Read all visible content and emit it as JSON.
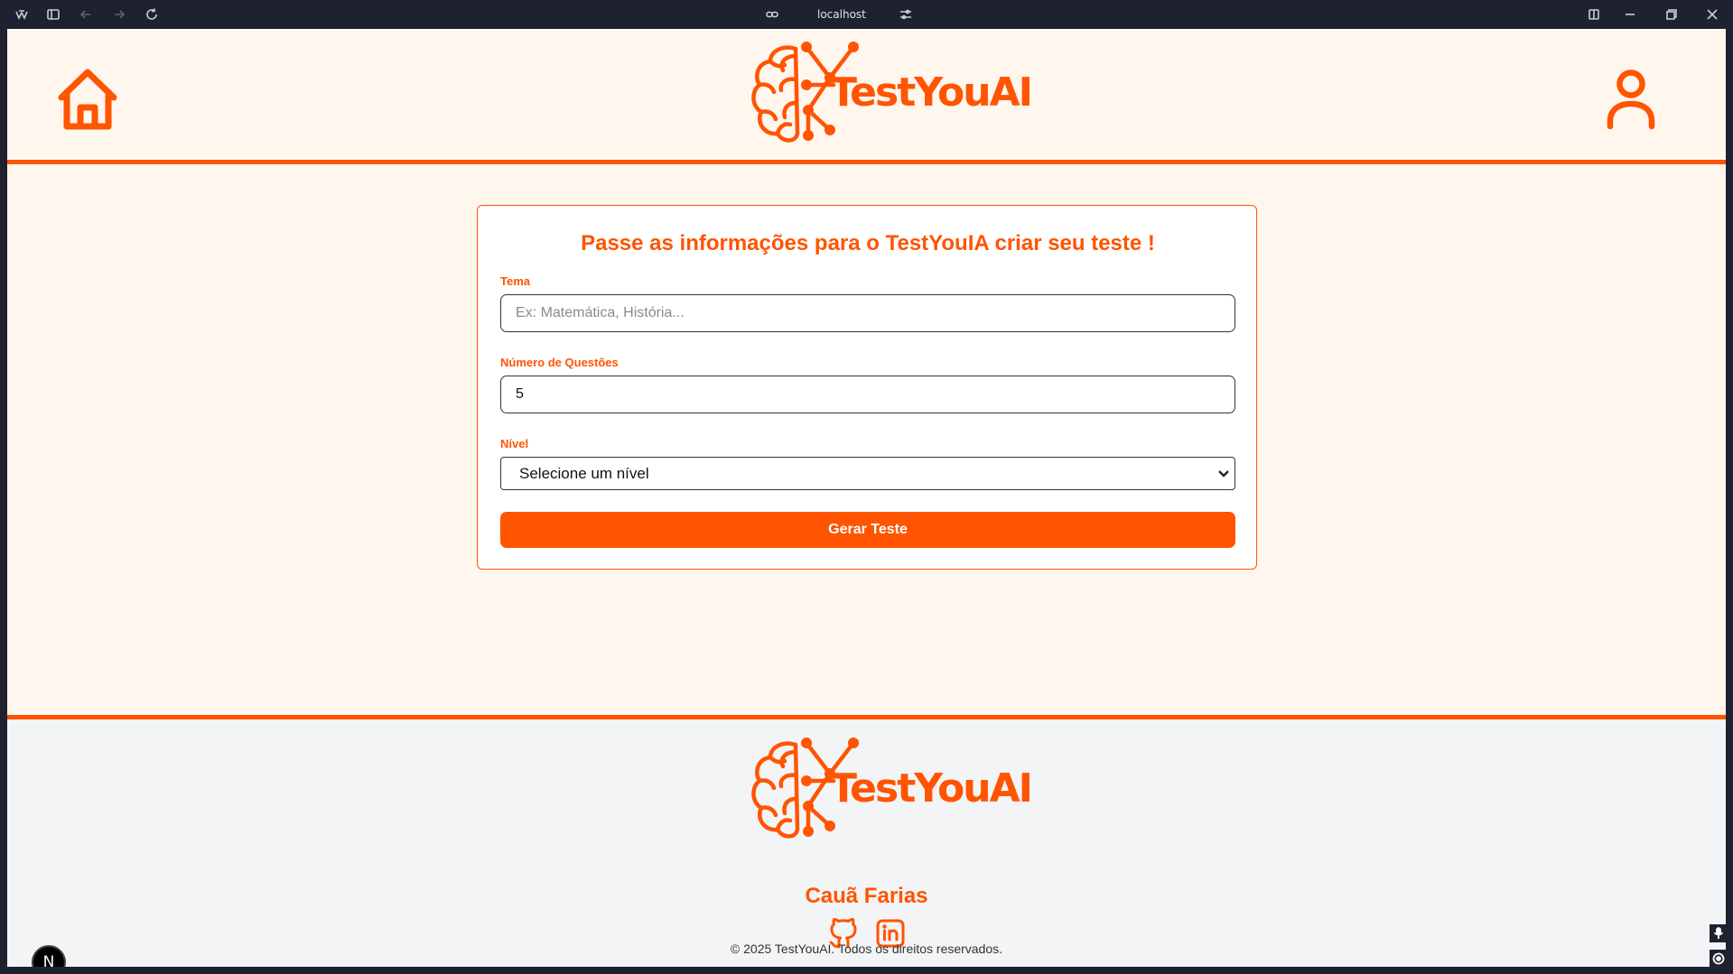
{
  "browser": {
    "url": "localhost"
  },
  "header": {
    "logo_text": "TestYouAI"
  },
  "form": {
    "title": "Passe as informações para o TestYouIA criar seu teste !",
    "tema_label": "Tema",
    "tema_placeholder": "Ex: Matemática, História...",
    "tema_value": "",
    "questoes_label": "Número de Questões",
    "questoes_value": "5",
    "nivel_label": "Nível",
    "nivel_selected": "Selecione um nível",
    "submit_label": "Gerar Teste"
  },
  "footer": {
    "logo_text": "TestYouAI",
    "author": "Cauã Farias",
    "copyright": "© 2025 TestYouAI. Todos os direitos reservados."
  },
  "dev_badge": "N",
  "colors": {
    "brand": "#ff5400",
    "page_bg": "#fff6ee",
    "footer_bg": "#f3f4f6"
  },
  "icons": [
    "home-icon",
    "user-icon",
    "github-icon",
    "linkedin-icon",
    "brain-circuit-logo"
  ]
}
